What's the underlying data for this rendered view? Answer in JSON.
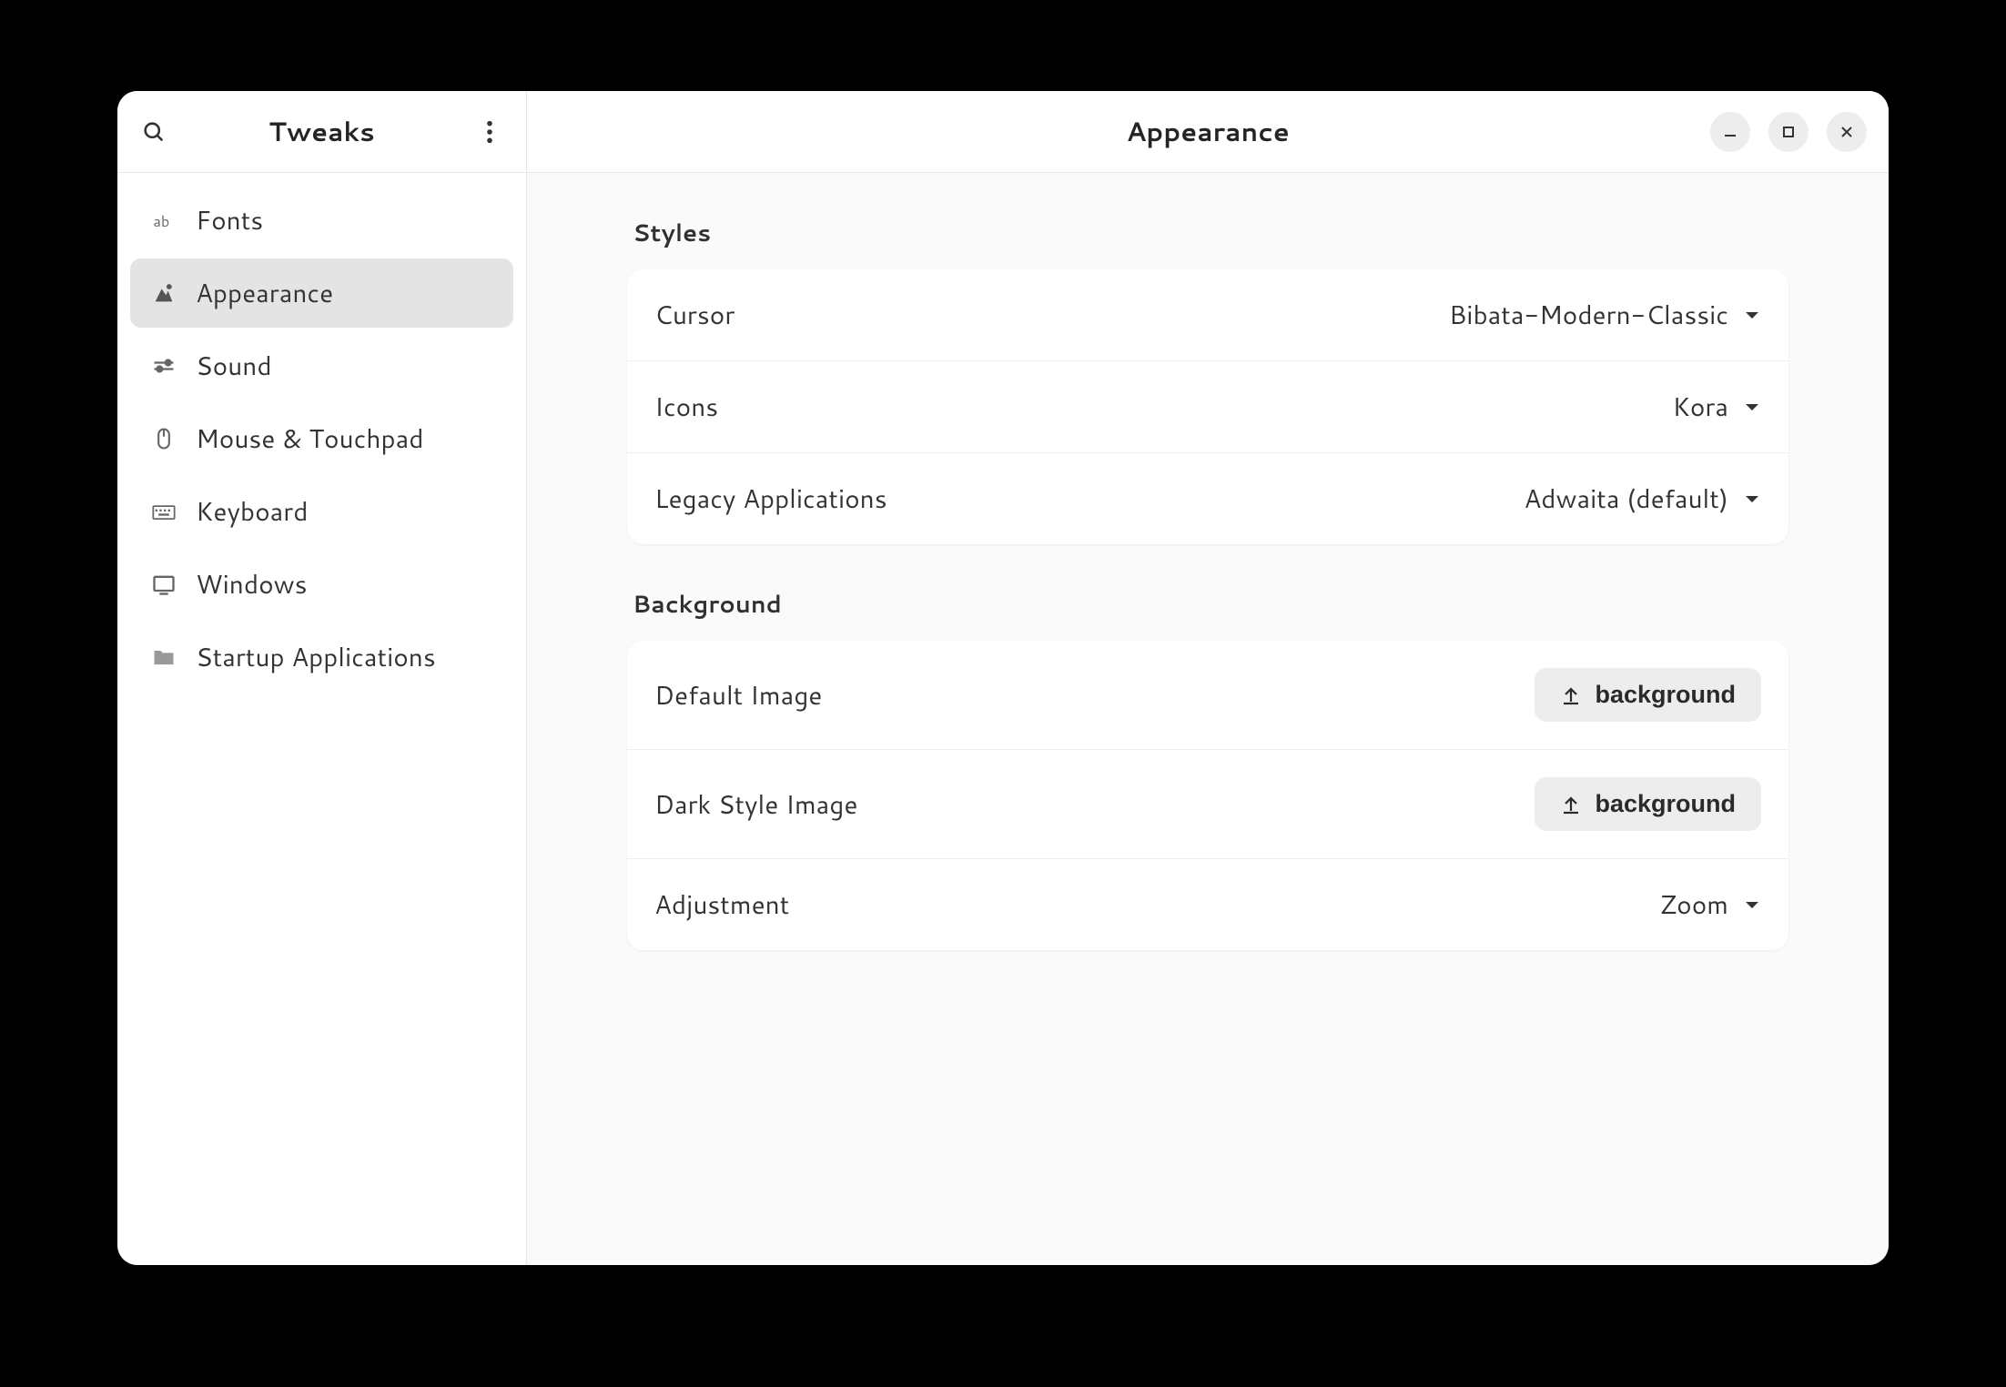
{
  "sidebar": {
    "title": "Tweaks",
    "items": [
      {
        "label": "Fonts"
      },
      {
        "label": "Appearance"
      },
      {
        "label": "Sound"
      },
      {
        "label": "Mouse & Touchpad"
      },
      {
        "label": "Keyboard"
      },
      {
        "label": "Windows"
      },
      {
        "label": "Startup Applications"
      }
    ]
  },
  "main": {
    "title": "Appearance",
    "sections": {
      "styles": {
        "title": "Styles",
        "rows": {
          "cursor": {
            "label": "Cursor",
            "value": "Bibata-Modern-Classic"
          },
          "icons": {
            "label": "Icons",
            "value": "Kora"
          },
          "legacy": {
            "label": "Legacy Applications",
            "value": "Adwaita (default)"
          }
        }
      },
      "background": {
        "title": "Background",
        "rows": {
          "default_image": {
            "label": "Default Image",
            "button": "background"
          },
          "dark_image": {
            "label": "Dark Style Image",
            "button": "background"
          },
          "adjustment": {
            "label": "Adjustment",
            "value": "Zoom"
          }
        }
      }
    }
  }
}
